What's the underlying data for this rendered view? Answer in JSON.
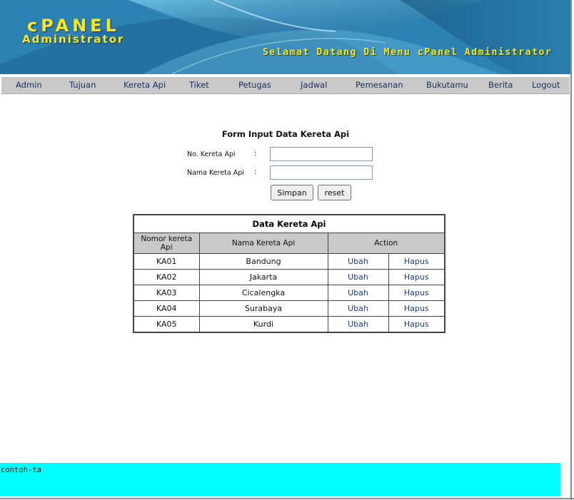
{
  "colors": {
    "banner_blue": "#2e7aa6",
    "brand_yellow": "#ffe81a",
    "nav_gray": "#c9c9c9",
    "link_blue": "#1a3a7a",
    "footer_cyan": "#00ffff"
  },
  "header": {
    "brand_title": "cPANEL",
    "brand_subtitle": "Administrator",
    "welcome": "Selamat Datang Di Menu cPanel Administrator"
  },
  "nav": {
    "items": [
      {
        "label": "Admin"
      },
      {
        "label": "Tujuan"
      },
      {
        "label": "Kereta Api"
      },
      {
        "label": "Tiket"
      },
      {
        "label": "Petugas"
      },
      {
        "label": "Jadwal"
      },
      {
        "label": "Pemesanan"
      },
      {
        "label": "Bukutamu"
      },
      {
        "label": "Berita"
      },
      {
        "label": "Logout"
      }
    ]
  },
  "form": {
    "title": "Form Input Data Kereta Api",
    "fields": [
      {
        "label": "No. Kereta Api",
        "colon": ":",
        "value": ""
      },
      {
        "label": "Nama Kereta Api",
        "colon": ":",
        "value": ""
      }
    ],
    "submit_label": "Simpan",
    "reset_label": "reset"
  },
  "table": {
    "caption": "Data Kereta Api",
    "headers": [
      "Nomor kereta Api",
      "Nama Kereta Api",
      "Action"
    ],
    "rows": [
      {
        "nomor": "KA01",
        "nama": "Bandung",
        "edit": "Ubah",
        "delete": "Hapus"
      },
      {
        "nomor": "KA02",
        "nama": "Jakarta",
        "edit": "Ubah",
        "delete": "Hapus"
      },
      {
        "nomor": "KA03",
        "nama": "Cicalengka",
        "edit": "Ubah",
        "delete": "Hapus"
      },
      {
        "nomor": "KA04",
        "nama": "Surabaya",
        "edit": "Ubah",
        "delete": "Hapus"
      },
      {
        "nomor": "KA05",
        "nama": "Kurdi",
        "edit": "Ubah",
        "delete": "Hapus"
      }
    ]
  },
  "footer": {
    "text": "contoh-ta"
  }
}
